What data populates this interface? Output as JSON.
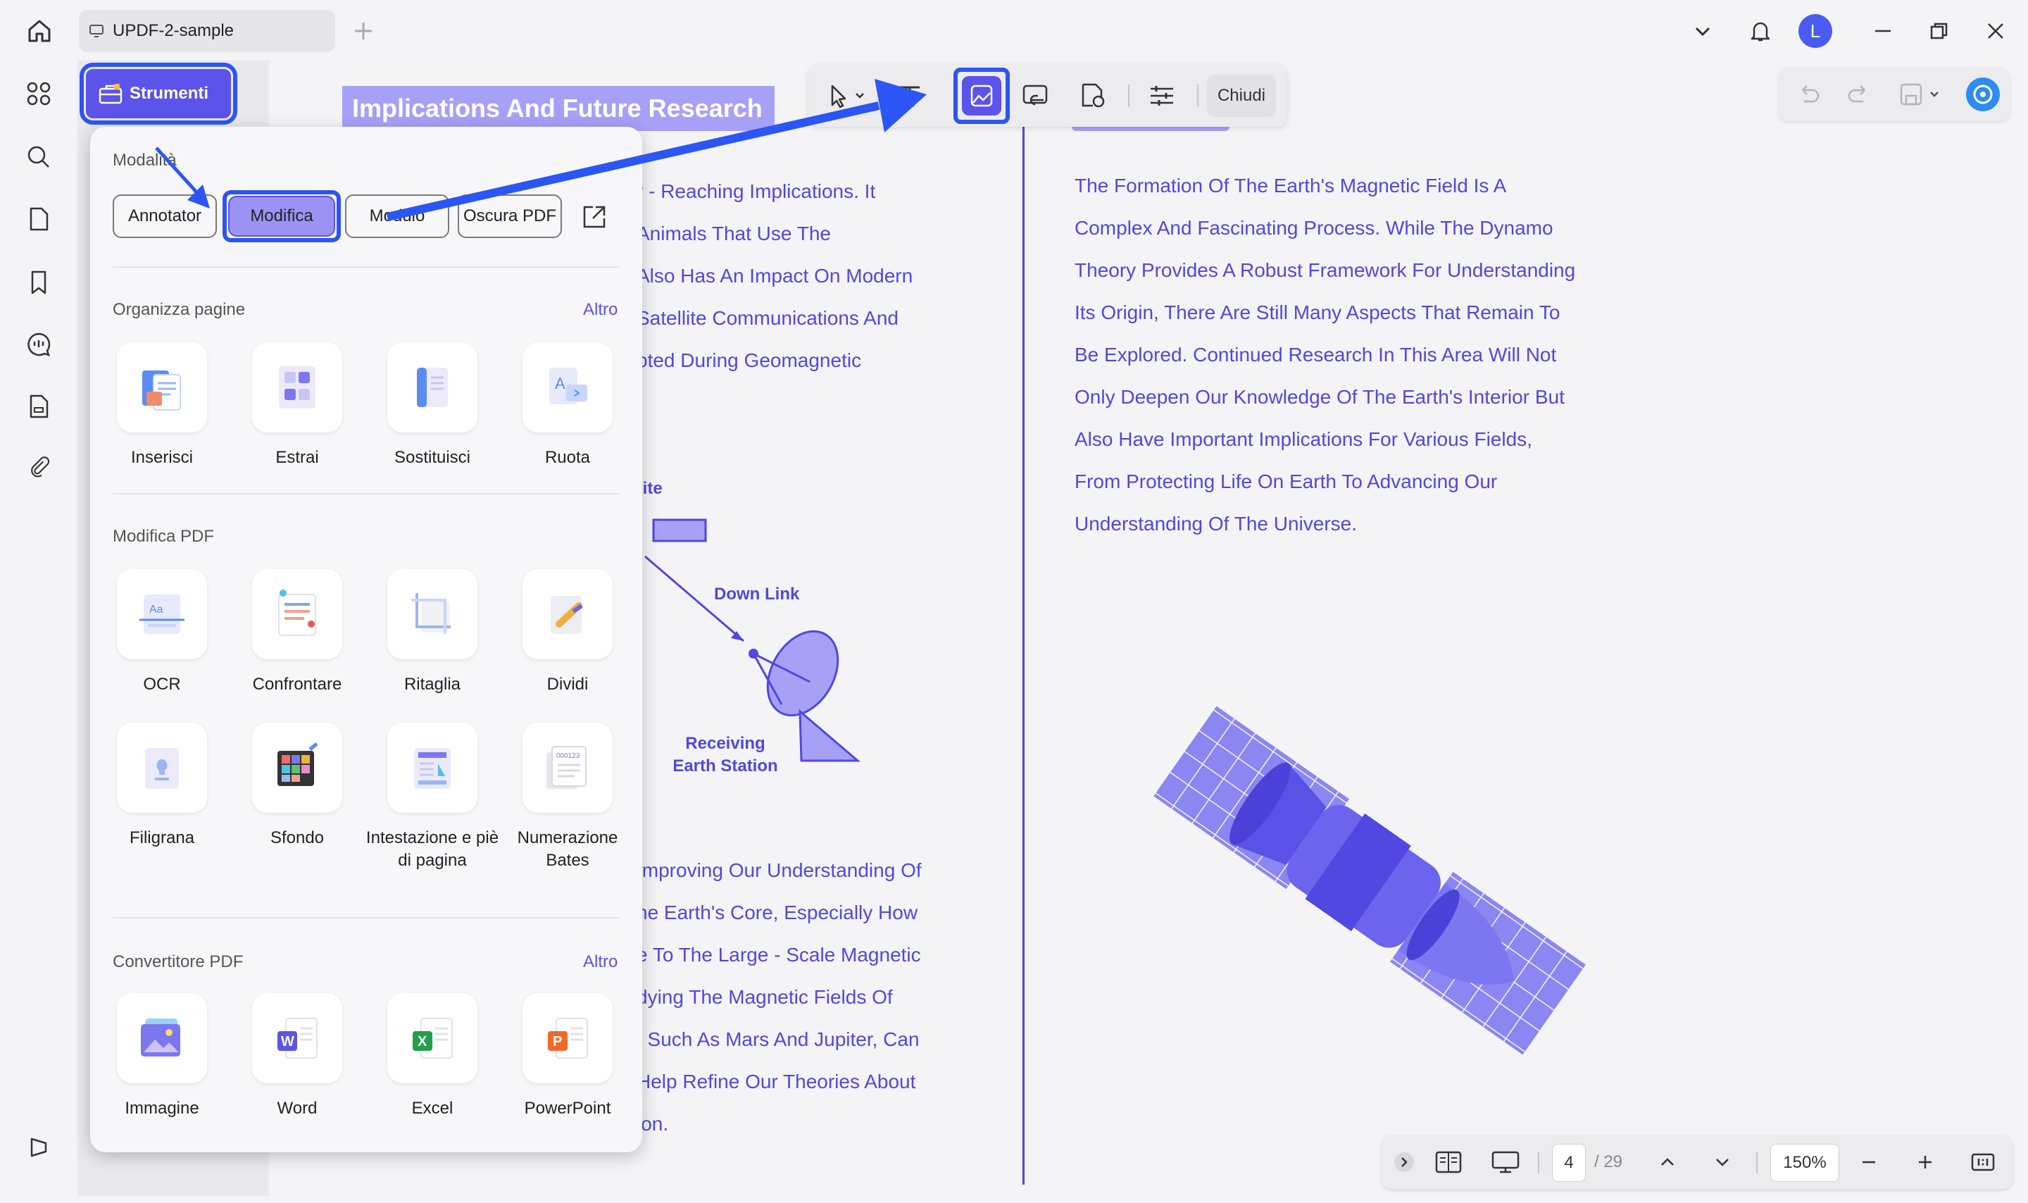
{
  "window": {
    "tab_title": "UPDF-2-sample",
    "avatar_initial": "L"
  },
  "tools_button": {
    "label": "Strumenti"
  },
  "toolbar": {
    "close_label": "Chiudi"
  },
  "popup": {
    "modes_title": "Modalità",
    "modes": [
      "Annotator",
      "Modifica",
      "Modulo",
      "Oscura PDF"
    ],
    "active_mode": "Modifica",
    "organize": {
      "title": "Organizza pagine",
      "more": "Altro",
      "items": [
        "Inserisci",
        "Estrai",
        "Sostituisci",
        "Ruota"
      ]
    },
    "edit": {
      "title": "Modifica PDF",
      "items": [
        "OCR",
        "Confrontare",
        "Ritaglia",
        "Dividi",
        "Filigrana",
        "Sfondo",
        "Intestazione e piè di pagina",
        "Numerazione Bates"
      ]
    },
    "convert": {
      "title": "Convertitore PDF",
      "more": "Altro",
      "items": [
        "Immagine",
        "Word",
        "Excel",
        "PowerPoint"
      ]
    }
  },
  "document": {
    "heading": "Implications And Future Research",
    "left_lines_top": [
      "r - Reaching Implications. It",
      "Animals That Use The",
      "Also Has An Impact On Modern",
      "Satellite Communications And",
      "pted During Geomagnetic"
    ],
    "diagram": {
      "satellite_label": "lite",
      "downlink_label": "Down Link",
      "station_label_1": "Receiving",
      "station_label_2": "Earth Station"
    },
    "left_lines_bottom": [
      "Improving Our Understanding Of",
      "he Earth's Core, Especially How",
      "e To The Large - Scale Magnetic",
      "dying The Magnetic Fields Of",
      ", Such As Mars And Jupiter, Can",
      "Help Refine Our Theories About",
      "ion."
    ],
    "right_lines": [
      "The Formation Of The Earth's Magnetic Field Is A",
      "Complex And Fascinating Process. While The Dynamo",
      "Theory Provides A Robust Framework For Understanding",
      "Its Origin, There Are Still Many Aspects That Remain To",
      "Be Explored. Continued Research In This Area Will Not",
      "Only Deepen Our Knowledge Of The Earth's Interior But",
      "Also Have Important Implications For Various Fields,",
      "From Protecting Life On Earth To Advancing Our",
      "Understanding Of The Universe."
    ]
  },
  "bottom_bar": {
    "current_page": "4",
    "total_pages": "/ 29",
    "zoom": "150%"
  },
  "colors": {
    "accent": "#5b53ea",
    "highlight_border": "#2c55f5",
    "doc_text": "#4f48e2"
  }
}
